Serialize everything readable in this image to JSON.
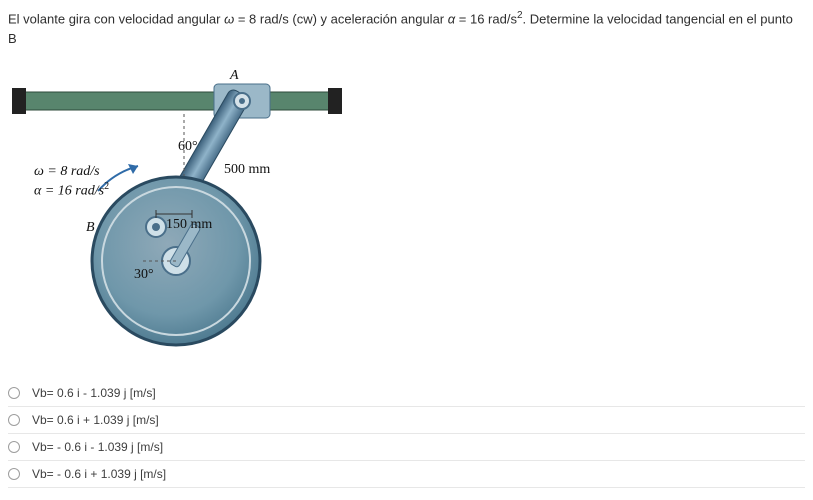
{
  "question": {
    "prefix": "El volante gira con velocidad angular ",
    "omega_sym": "ω",
    "mid1": " = 8 rad/s (cw) y aceleración angular ",
    "alpha_sym": "α",
    "mid2": " = 16 rad/s",
    "exp": "2",
    "suffix": ". Determine la velocidad tangencial en el punto B"
  },
  "figure": {
    "label_A": "A",
    "angle60": "60°",
    "angle30": "30°",
    "dim500": "500 mm",
    "dim150": "150 mm",
    "label_B": "B",
    "omega_line": "ω = 8 rad/s",
    "alpha_line": "α = 16 rad/s",
    "alpha_exp": "2"
  },
  "options": [
    {
      "label": "Vb= 0.6 i - 1.039 j [m/s]"
    },
    {
      "label": "Vb= 0.6 i + 1.039 j [m/s]"
    },
    {
      "label": "Vb= - 0.6 i - 1.039 j [m/s]"
    },
    {
      "label": "Vb= - 0.6 i + 1.039 j [m/s]"
    }
  ]
}
